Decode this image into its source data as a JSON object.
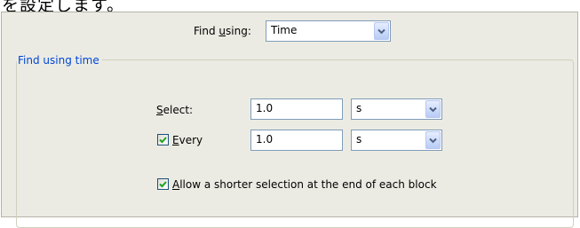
{
  "header_text": "を設定します。",
  "find_using": {
    "label_pre": "Find ",
    "label_mnemonic": "u",
    "label_post": "sing:",
    "value": "Time"
  },
  "group": {
    "title": "Find using time"
  },
  "select_row": {
    "label_mnemonic": "S",
    "label_post": "elect:",
    "value": "1.0",
    "unit": "s"
  },
  "every_row": {
    "checked": true,
    "label_mnemonic": "E",
    "label_post": "very",
    "value": "1.0",
    "unit": "s"
  },
  "allow_shorter": {
    "checked": true,
    "label_mnemonic": "A",
    "label_post": "llow a shorter selection at the end of each block"
  },
  "colors": {
    "panel_bg": "#ecebe3",
    "group_title": "#0046d5",
    "check_mark": "#21a121",
    "arrow": "#4d6185"
  },
  "icons": [
    "chevron-down-icon",
    "checkmark-icon"
  ]
}
